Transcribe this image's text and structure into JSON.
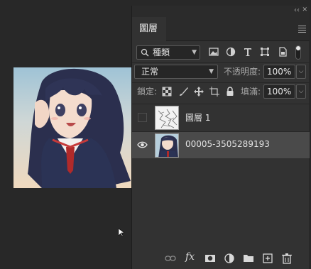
{
  "canvas": {
    "image_alt": "anime girl illustration"
  },
  "panel": {
    "collapse_glyph": "‹‹",
    "close_glyph": "✕",
    "tab_label": "圖層",
    "filter": {
      "kind_label": "種類"
    },
    "blend": {
      "mode": "正常",
      "opacity_label": "不透明度:",
      "opacity_value": "100%"
    },
    "lock": {
      "label": "鎖定:",
      "fill_label": "填滿:",
      "fill_value": "100%"
    },
    "layers": [
      {
        "name": "圖層 1",
        "visible": false,
        "selected": false
      },
      {
        "name": "00005-3505289193",
        "visible": true,
        "selected": true
      }
    ],
    "bottom_icons": [
      "link-icon",
      "fx-icon",
      "mask-icon",
      "adjustment-icon",
      "folder-icon",
      "new-layer-icon",
      "trash-icon"
    ],
    "fx_label": "fx"
  },
  "colors": {
    "background": "#282828",
    "panel": "#323232",
    "selected_row": "#4a4a4a"
  }
}
